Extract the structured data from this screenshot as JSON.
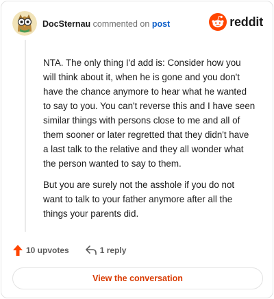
{
  "header": {
    "username": "DocSternau",
    "action_text": "commented on",
    "target_link": "post",
    "brand_name": "reddit"
  },
  "comment": {
    "paragraphs": [
      "NTA. The only thing I'd add is: Consider how you will think about it, when he is gone and you don't have the chance anymore to hear what he wanted to say to you. You can't reverse this and I have seen similar things with persons close to me and all of them sooner or later regretted that they didn't have a last talk to the relative and they all wonder what the person wanted to say to them.",
      "But you are surely not the asshole if you do not want to talk to your father anymore after all the things your parents did."
    ]
  },
  "actions": {
    "upvotes": "10 upvotes",
    "replies": "1 reply"
  },
  "cta": {
    "label": "View the conversation"
  },
  "colors": {
    "brand_orange": "#ff4500",
    "upvote_orange": "#ff4500",
    "cta_text": "#d93a00",
    "link_blue": "#0b5ec9"
  },
  "icons": {
    "avatar": "owl-avatar-icon",
    "brand": "reddit-snoo-icon",
    "upvote": "upvote-arrow-icon",
    "reply": "reply-arrow-icon"
  }
}
